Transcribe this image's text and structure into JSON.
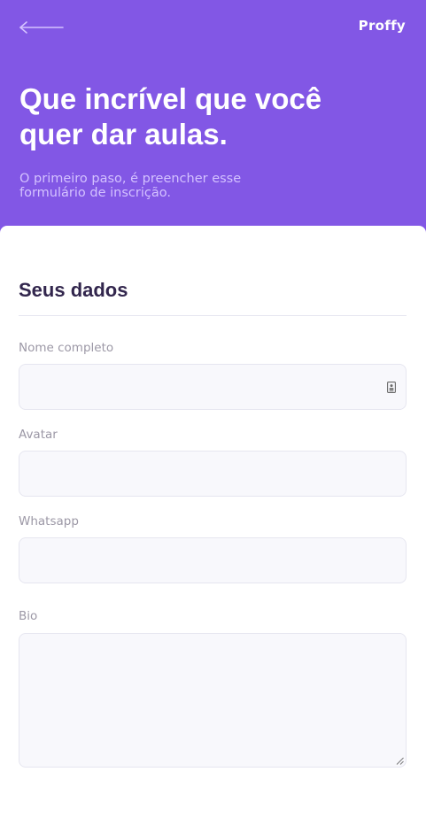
{
  "header": {
    "logo": "Proffy",
    "title_line1": "Que incrível que você",
    "title_line2": "quer dar aulas.",
    "subtitle_line1": "O primeiro paso, é preencher esse",
    "subtitle_line2": "formulário de inscrição.",
    "background_color": "#8257e5",
    "back_icon": "arrow-left-icon"
  },
  "form": {
    "section_title": "Seus dados",
    "fields": [
      {
        "label": "Nome completo",
        "value": "",
        "has_contact_icon": true
      },
      {
        "label": "Avatar",
        "value": ""
      },
      {
        "label": "Whatsapp",
        "value": ""
      },
      {
        "label": "Bio",
        "value": "",
        "multiline": true
      }
    ]
  }
}
